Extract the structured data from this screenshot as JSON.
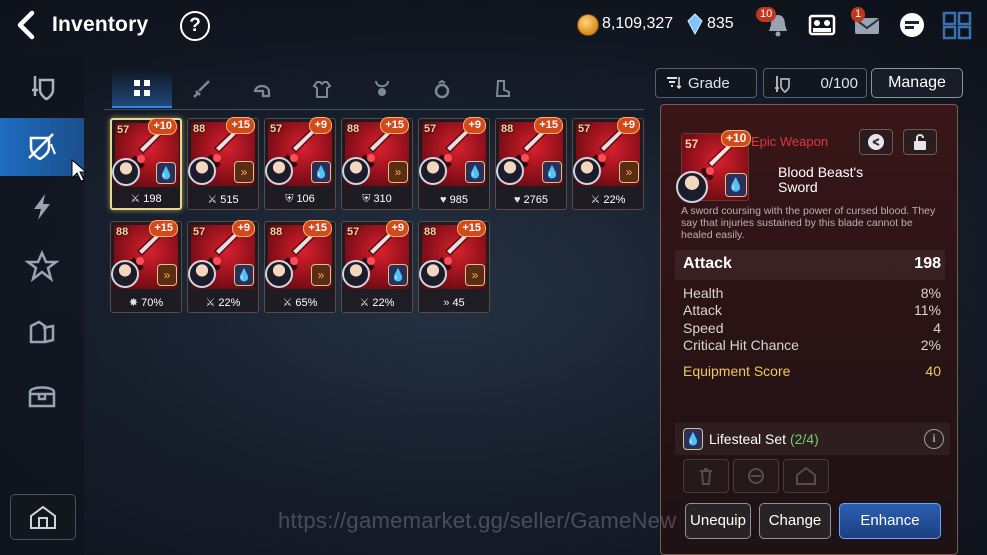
{
  "header": {
    "title": "Inventory",
    "help": "?"
  },
  "currency": {
    "gold": "8,109,327",
    "crystals": "835"
  },
  "badges": {
    "notifications": "10",
    "mail": "1"
  },
  "filters": {
    "grade_label": "Grade",
    "capacity": "0/100",
    "manage_label": "Manage"
  },
  "sidebar": {
    "items": [
      "equipment-shield",
      "equipment-broken-shield",
      "lightning",
      "artifact",
      "bags",
      "chest"
    ],
    "active": 1
  },
  "tabs": {
    "active": 0,
    "items": [
      "all",
      "weapon",
      "helmet",
      "armor",
      "necklace",
      "ring",
      "boots"
    ]
  },
  "items": [
    {
      "level": "57",
      "plus": "+10",
      "set": "lifesteal",
      "stat_icon": "attack",
      "stat": "198",
      "selected": true
    },
    {
      "level": "88",
      "plus": "+15",
      "set": "counter",
      "stat_icon": "attack",
      "stat": "515"
    },
    {
      "level": "57",
      "plus": "+9",
      "set": "lifesteal",
      "stat_icon": "defense",
      "stat": "106"
    },
    {
      "level": "88",
      "plus": "+15",
      "set": "immunity",
      "stat_icon": "defense",
      "stat": "310"
    },
    {
      "level": "57",
      "plus": "+9",
      "set": "lifesteal",
      "stat_icon": "health",
      "stat": "985"
    },
    {
      "level": "88",
      "plus": "+15",
      "set": "lifesteal",
      "stat_icon": "health",
      "stat": "2765"
    },
    {
      "level": "57",
      "plus": "+9",
      "set": "counter",
      "stat_icon": "attack",
      "stat": "22%"
    },
    {
      "level": "88",
      "plus": "+15",
      "set": "counter",
      "stat_icon": "critical",
      "stat": "70%"
    },
    {
      "level": "57",
      "plus": "+9",
      "set": "lifesteal",
      "stat_icon": "attack",
      "stat": "22%"
    },
    {
      "level": "88",
      "plus": "+15",
      "set": "immunity",
      "stat_icon": "attack",
      "stat": "65%"
    },
    {
      "level": "57",
      "plus": "+9",
      "set": "lifesteal",
      "stat_icon": "attack",
      "stat": "22%"
    },
    {
      "level": "88",
      "plus": "+15",
      "set": "counter",
      "stat_icon": "speed",
      "stat": "45"
    }
  ],
  "detail": {
    "level": "57",
    "plus": "+10",
    "rarity": "Epic Weapon",
    "name": "Blood Beast's Sword",
    "description": "A sword coursing with the power of cursed blood. They say that injuries sustained by this blade cannot be healed easily.",
    "main_stat": {
      "label": "Attack",
      "value": "198"
    },
    "sub_stats": [
      {
        "label": "Health",
        "value": "8%"
      },
      {
        "label": "Attack",
        "value": "11%"
      },
      {
        "label": "Speed",
        "value": "4"
      },
      {
        "label": "Critical Hit Chance",
        "value": "2%"
      }
    ],
    "score": {
      "label": "Equipment Score",
      "value": "40"
    },
    "set": {
      "name": "Lifesteal Set",
      "count": "(2/4)"
    },
    "buttons": {
      "unequip": "Unequip",
      "change": "Change",
      "enhance": "Enhance"
    }
  },
  "watermark": "https://gamemarket.gg/seller/GameNew",
  "colors": {
    "accent_blue": "#1e6cc2",
    "rarity_epic": "#e0363f",
    "score_gold": "#f0c95a",
    "set_count_green": "#6fd06a"
  }
}
